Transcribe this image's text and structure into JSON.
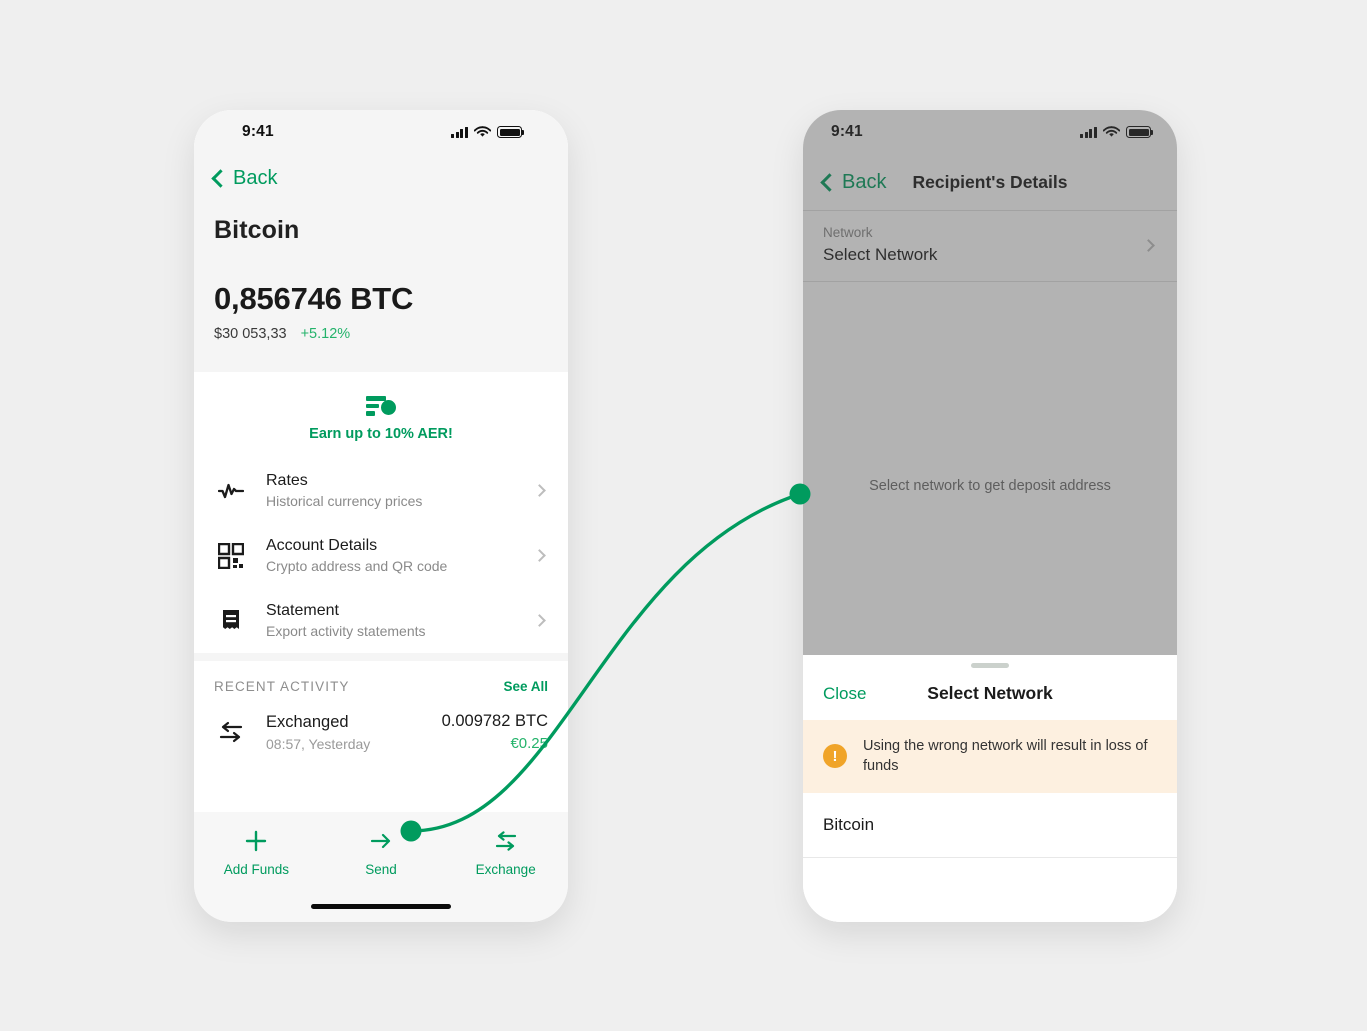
{
  "theme": {
    "accent": "#009B5E",
    "accent_light": "#24B36B",
    "warning": "#F0A429",
    "warning_bg": "#FDF0E0"
  },
  "left_phone": {
    "status_bar": {
      "time": "9:41",
      "signal_icon": "cellular-signal-icon",
      "wifi_icon": "wifi-icon",
      "battery_icon": "battery-full-icon"
    },
    "nav": {
      "back_label": "Back",
      "back_icon": "chevron-left-icon"
    },
    "asset": {
      "name": "Bitcoin",
      "balance": "0,856746 BTC",
      "fiat_value": "$30 053,33",
      "change": "+5.12%"
    },
    "promo": {
      "icon": "earn-rate-icon",
      "text": "Earn up to 10% AER!"
    },
    "menu": [
      {
        "icon": "pulse-chart-icon",
        "title": "Rates",
        "subtitle": "Historical currency prices",
        "chevron": "chevron-right-icon"
      },
      {
        "icon": "qr-code-icon",
        "title": "Account Details",
        "subtitle": "Crypto address and QR code",
        "chevron": "chevron-right-icon"
      },
      {
        "icon": "receipt-icon",
        "title": "Statement",
        "subtitle": "Export activity statements",
        "chevron": "chevron-right-icon"
      }
    ],
    "activity": {
      "heading": "RECENT ACTIVITY",
      "see_all": "See All",
      "rows": [
        {
          "icon": "exchange-arrows-icon",
          "name": "Exchanged",
          "time": "08:57, Yesterday",
          "amount": "0.009782 BTC",
          "fiat": "€0.25"
        }
      ]
    },
    "tabs": [
      {
        "icon": "plus-icon",
        "label": "Add Funds"
      },
      {
        "icon": "arrow-right-icon",
        "label": "Send"
      },
      {
        "icon": "exchange-arrows-icon",
        "label": "Exchange"
      }
    ]
  },
  "right_phone": {
    "status_bar": {
      "time": "9:41",
      "signal_icon": "cellular-signal-icon",
      "wifi_icon": "wifi-icon",
      "battery_icon": "battery-full-icon"
    },
    "nav": {
      "back_label": "Back",
      "back_icon": "chevron-left-icon",
      "title": "Recipient's Details"
    },
    "network_row": {
      "label": "Network",
      "value": "Select Network",
      "chevron": "chevron-right-icon"
    },
    "body_hint": "Select network to get deposit address",
    "sheet": {
      "handle": "drag-handle",
      "close_label": "Close",
      "title": "Select Network",
      "warning": {
        "icon": "warning-exclamation-icon",
        "text": "Using the wrong network will result in loss of funds"
      },
      "options": [
        {
          "label": "Bitcoin"
        }
      ]
    }
  },
  "connector": {
    "start_dot": "flow-start-dot",
    "end_dot": "flow-end-dot",
    "color": "#009B5E"
  }
}
